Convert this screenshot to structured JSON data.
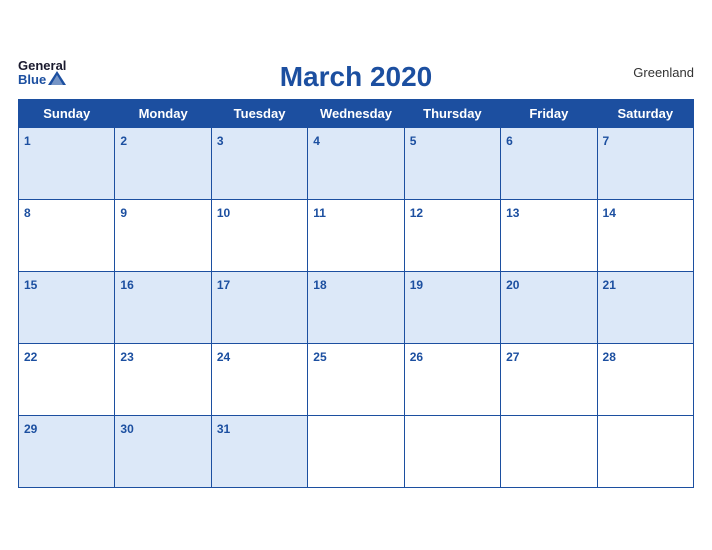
{
  "header": {
    "logo_general": "General",
    "logo_blue": "Blue",
    "title": "March 2020",
    "region": "Greenland"
  },
  "weekdays": [
    "Sunday",
    "Monday",
    "Tuesday",
    "Wednesday",
    "Thursday",
    "Friday",
    "Saturday"
  ],
  "weeks": [
    [
      {
        "day": "1",
        "empty": false
      },
      {
        "day": "2",
        "empty": false
      },
      {
        "day": "3",
        "empty": false
      },
      {
        "day": "4",
        "empty": false
      },
      {
        "day": "5",
        "empty": false
      },
      {
        "day": "6",
        "empty": false
      },
      {
        "day": "7",
        "empty": false
      }
    ],
    [
      {
        "day": "8",
        "empty": false
      },
      {
        "day": "9",
        "empty": false
      },
      {
        "day": "10",
        "empty": false
      },
      {
        "day": "11",
        "empty": false
      },
      {
        "day": "12",
        "empty": false
      },
      {
        "day": "13",
        "empty": false
      },
      {
        "day": "14",
        "empty": false
      }
    ],
    [
      {
        "day": "15",
        "empty": false
      },
      {
        "day": "16",
        "empty": false
      },
      {
        "day": "17",
        "empty": false
      },
      {
        "day": "18",
        "empty": false
      },
      {
        "day": "19",
        "empty": false
      },
      {
        "day": "20",
        "empty": false
      },
      {
        "day": "21",
        "empty": false
      }
    ],
    [
      {
        "day": "22",
        "empty": false
      },
      {
        "day": "23",
        "empty": false
      },
      {
        "day": "24",
        "empty": false
      },
      {
        "day": "25",
        "empty": false
      },
      {
        "day": "26",
        "empty": false
      },
      {
        "day": "27",
        "empty": false
      },
      {
        "day": "28",
        "empty": false
      }
    ],
    [
      {
        "day": "29",
        "empty": false
      },
      {
        "day": "30",
        "empty": false
      },
      {
        "day": "31",
        "empty": false
      },
      {
        "day": "",
        "empty": true
      },
      {
        "day": "",
        "empty": true
      },
      {
        "day": "",
        "empty": true
      },
      {
        "day": "",
        "empty": true
      }
    ]
  ]
}
